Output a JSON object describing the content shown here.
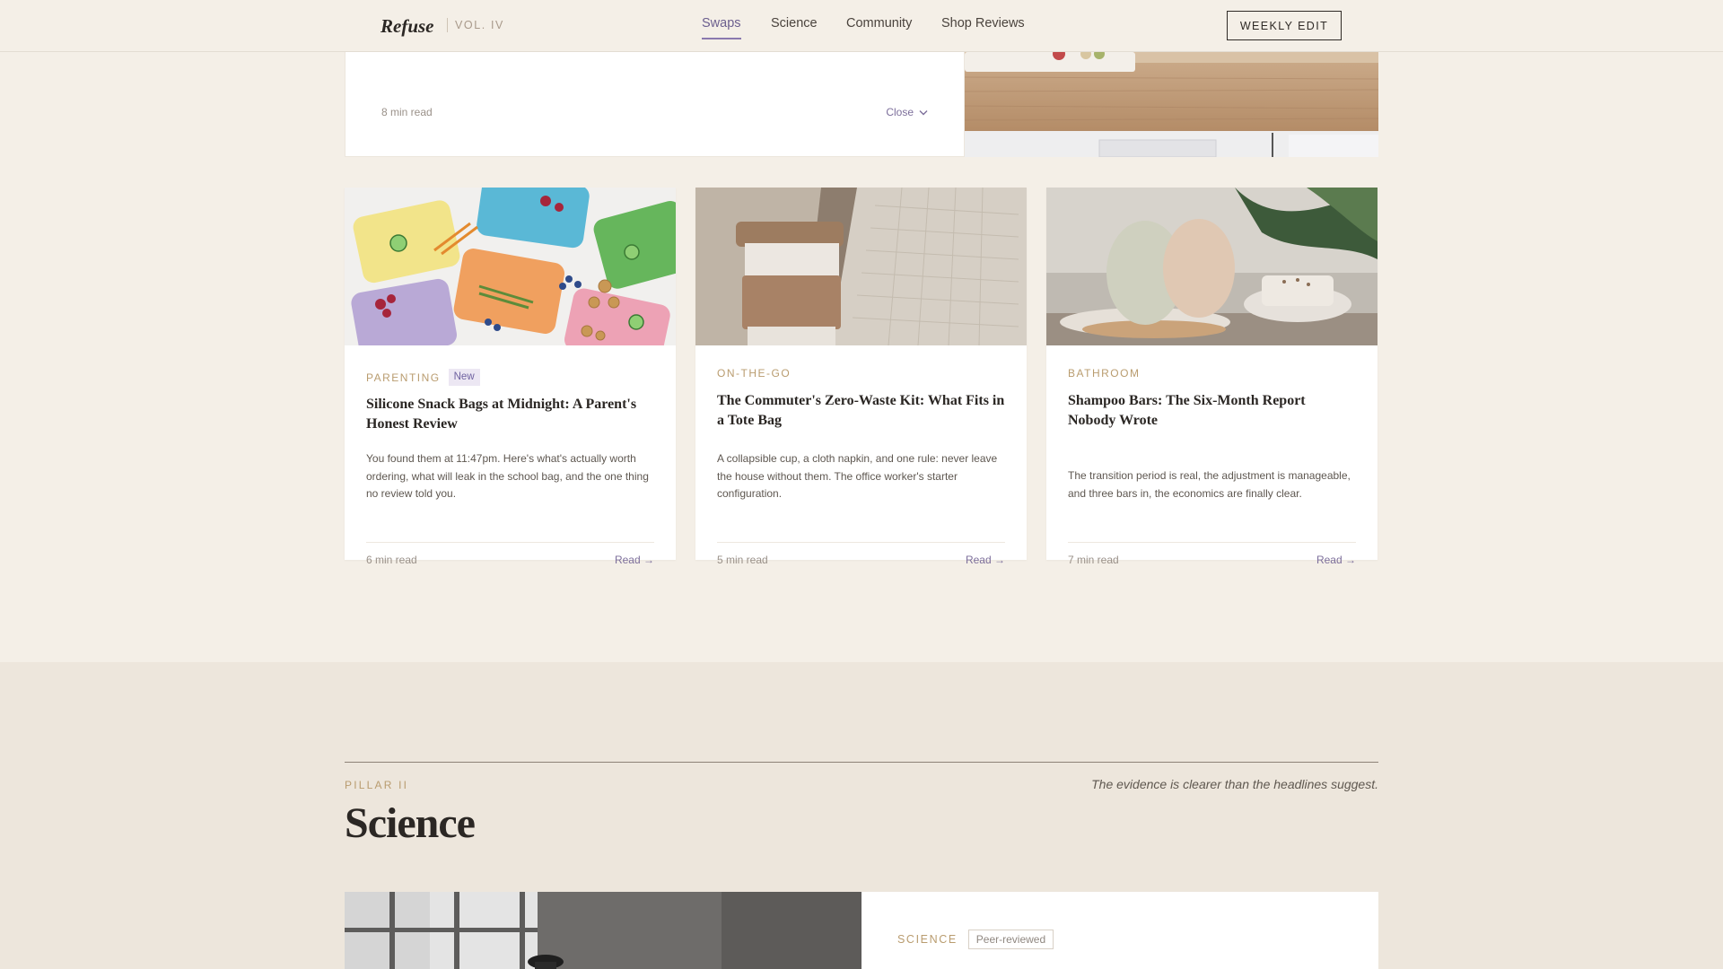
{
  "header": {
    "logo": "Refuse",
    "volume": "VOL. IV",
    "nav": [
      {
        "label": "Swaps",
        "active": true
      },
      {
        "label": "Science",
        "active": false
      },
      {
        "label": "Community",
        "active": false
      },
      {
        "label": "Shop Reviews",
        "active": false
      }
    ],
    "cta": "WEEKLY EDIT"
  },
  "featured_top": {
    "read_time": "8 min read",
    "close_label": "Close",
    "close_icon": "chevron-down-icon"
  },
  "cards": [
    {
      "category": "PARENTING",
      "tag": "New",
      "title": "Silicone Snack Bags at Midnight: A Parent's Honest Review",
      "excerpt": "You found them at 11:47pm. Here's what's actually worth ordering, what will leak in the school bag, and the one thing no review told you.",
      "read_time": "6 min read",
      "read_label": "Read →"
    },
    {
      "category": "ON-THE-GO",
      "title": "The Commuter's Zero-Waste Kit: What Fits in a Tote Bag",
      "excerpt": "A collapsible cup, a cloth napkin, and one rule: never leave the house without them. The office worker's starter configuration.",
      "read_time": "5 min read",
      "read_label": "Read →"
    },
    {
      "category": "BATHROOM",
      "title": "Shampoo Bars: The Six-Month Report Nobody Wrote",
      "excerpt": "The transition period is real, the adjustment is manageable, and three bars in, the economics are finally clear.",
      "read_time": "7 min read",
      "read_label": "Read →"
    }
  ],
  "science": {
    "pillar": "PILLAR II",
    "tagline": "The evidence is clearer than the headlines suggest.",
    "title": "Science",
    "card_category": "SCIENCE",
    "card_badge": "Peer-reviewed"
  }
}
